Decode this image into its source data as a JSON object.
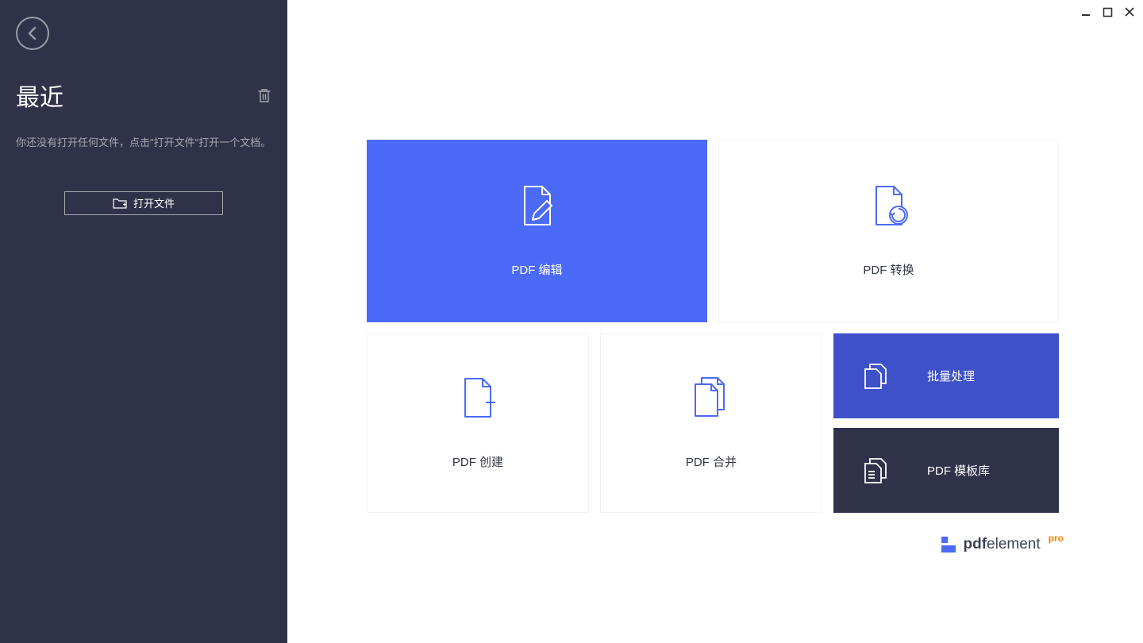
{
  "sidebar": {
    "title": "最近",
    "hint": "你还没有打开任何文件，点击\"打开文件\"打开一个文档。",
    "open_label": "打开文件"
  },
  "tiles": {
    "edit": "PDF 编辑",
    "convert": "PDF 转换",
    "create": "PDF 创建",
    "merge": "PDF 合并",
    "batch": "批量处理",
    "template": "PDF 模板库"
  },
  "brand": {
    "name_bold": "pdf",
    "name_light": "element",
    "suffix": "pro"
  },
  "colors": {
    "primary": "#4b6af7",
    "dark": "#2f3249",
    "blue2": "#3f51c8"
  }
}
